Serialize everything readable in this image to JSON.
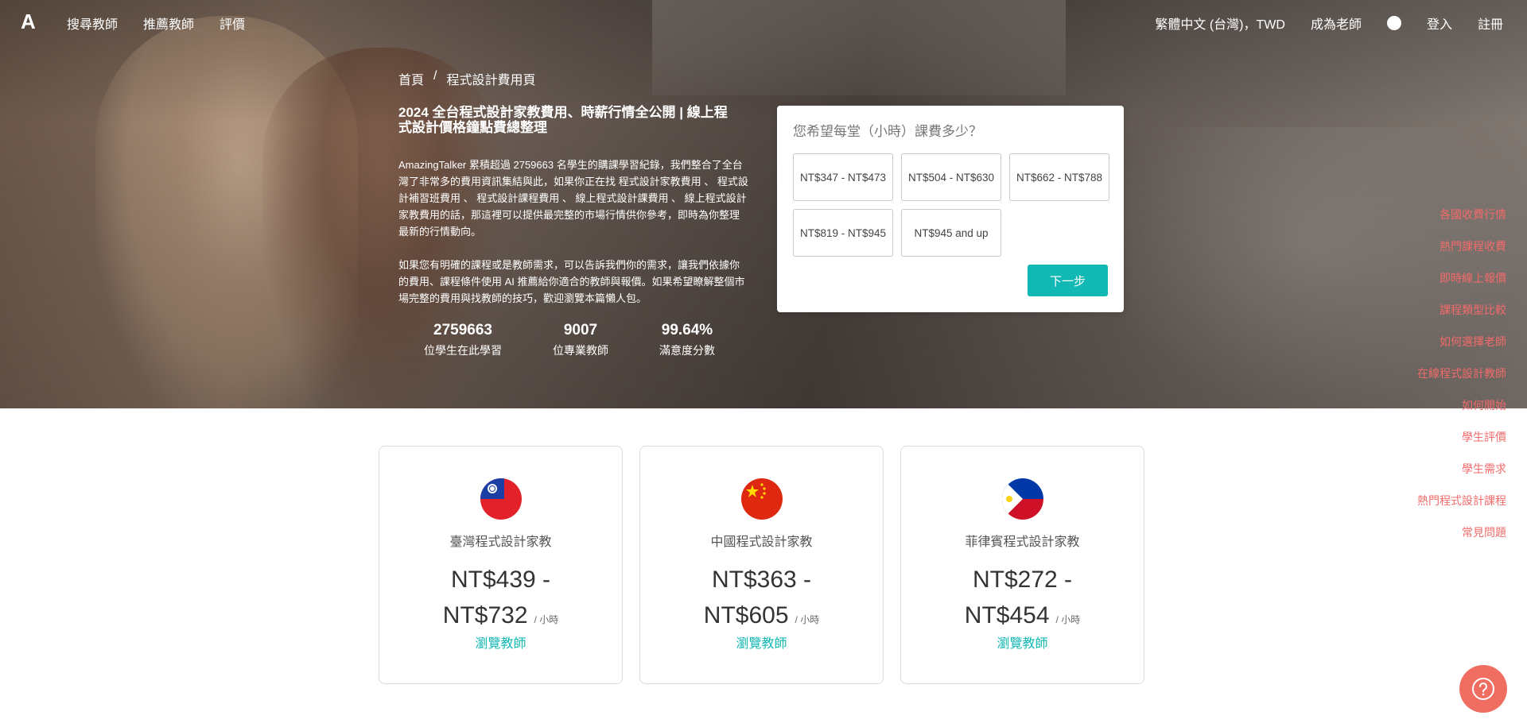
{
  "nav": {
    "logo": "A",
    "left": [
      "搜尋教師",
      "推薦教師",
      "評價"
    ],
    "language": "繁體中文 (台灣)，TWD",
    "become_teacher": "成為老師",
    "help": "?",
    "login": "登入",
    "signup": "註冊"
  },
  "breadcrumb": {
    "home": "首頁",
    "separator": "/",
    "current": "程式設計費用頁"
  },
  "hero": {
    "title": "2024 全台程式設計家教費用、時薪行情全公開 | 線上程式設計價格鐘點費總整理",
    "p1": "AmazingTalker 累積超過 2759663 名學生的購課學習紀錄，我們整合了全台灣了非常多的費用資訊集結與此，如果你正在找 程式設計家教費用 、 程式設計補習班費用 、 程式設計課程費用 、 線上程式設計課費用 、 線上程式設計家教費用的話，那這裡可以提供最完整的市場行情供你參考，即時為你整理最新的行情動向。",
    "p2": "如果您有明確的課程或是教師需求，可以告訴我們你的需求，讓我們依據你的費用、課程條件使用 AI 推薦給你適合的教師與報價。如果希望瞭解整個市場完整的費用與找教師的技巧，歡迎瀏覽本篇懶人包。",
    "stats": [
      {
        "num": "2759663",
        "label": "位學生在此學習"
      },
      {
        "num": "9007",
        "label": "位專業教師"
      },
      {
        "num": "99.64%",
        "label": "滿意度分數"
      }
    ]
  },
  "quiz": {
    "question": "您希望每堂（小時）課費多少？",
    "options": [
      "NT$347 - NT$473",
      "NT$504 - NT$630",
      "NT$662 - NT$788",
      "NT$819 - NT$945",
      "NT$945 and up"
    ],
    "next": "下一步"
  },
  "side_nav": [
    "各國收費行情",
    "熱門課程收費",
    "即時線上報價",
    "課程類型比較",
    "如何選擇老師",
    "在線程式設計教師",
    "如何開始",
    "學生評價",
    "學生需求",
    "熱門程式設計課程",
    "常見問題"
  ],
  "cards": [
    {
      "label": "臺灣程式設計家教",
      "price_line1": "NT$439 -",
      "price_line2": "NT$732",
      "per": "/ 小時",
      "browse": "瀏覽教師",
      "flag": "taiwan-flag"
    },
    {
      "label": "中國程式設計家教",
      "price_line1": "NT$363 -",
      "price_line2": "NT$605",
      "per": "/ 小時",
      "browse": "瀏覽教師",
      "flag": "china-flag"
    },
    {
      "label": "菲律賓程式設計家教",
      "price_line1": "NT$272 -",
      "price_line2": "NT$454",
      "per": "/ 小時",
      "browse": "瀏覽教師",
      "flag": "philippines-flag"
    }
  ],
  "colors": {
    "accent": "#12b8b4",
    "side_nav": "#f26b6b",
    "fab": "#f06d62"
  }
}
